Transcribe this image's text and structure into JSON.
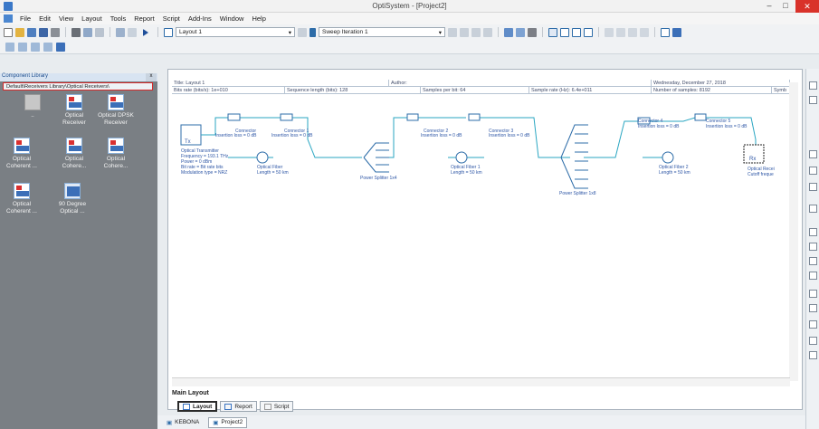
{
  "window": {
    "title": "OptiSystem - [Project2]",
    "min_glyph": "–",
    "max_glyph": "□",
    "close_glyph": "✕"
  },
  "menu": [
    "File",
    "Edit",
    "View",
    "Layout",
    "Tools",
    "Report",
    "Script",
    "Add-Ins",
    "Window",
    "Help"
  ],
  "toolbar": {
    "layout_combo": "Layout 1",
    "sweep_combo": "Sweep Iteration 1"
  },
  "library": {
    "header": "Component Library",
    "close": "x",
    "path": "Default\\Receivers Library\\Optical Receivers\\",
    "items": [
      {
        "label": ".."
      },
      {
        "label": "Optical Receiver"
      },
      {
        "label": "Optical DPSK Receiver"
      },
      {
        "label": "Optical Coherent ..."
      },
      {
        "label": "Optical Cohere..."
      },
      {
        "label": "Optical Cohere..."
      },
      {
        "label": "Optical Coherent ..."
      },
      {
        "label": "90 Degree Optical ..."
      }
    ]
  },
  "info": {
    "row1": [
      "Title: Layout 1",
      "Author:",
      "Wednesday, December 27, 2018"
    ],
    "row2": [
      "Bits rate (bits/s): 1e+010",
      "Sequence length (bits): 128",
      "Samples per bit: 64",
      "Sample rate (Hz): 6.4e+011",
      "Number of samples: 8192",
      "Symb"
    ]
  },
  "canvas": {
    "transmitter": {
      "title": "Tx",
      "lines": [
        "Optical Transmitter",
        "Frequency = 193.1 THz",
        "Power = 0 dBm",
        "Bit rate = Bit rate bits",
        "Modulation type = NRZ"
      ]
    },
    "connectors": [
      {
        "name": "Connector",
        "param": "Insertion loss = 0 dB"
      },
      {
        "name": "Connector 1",
        "param": "Insertion loss = 0 dB"
      },
      {
        "name": "Connector 2",
        "param": "Insertion loss = 0 dB"
      },
      {
        "name": "Connector 3",
        "param": "Insertion loss = 0 dB"
      },
      {
        "name": "Connector 4",
        "param": "Insertion loss = 0 dB"
      },
      {
        "name": "Connector 5",
        "param": "Insertion loss = 0 dB"
      }
    ],
    "fibers": [
      {
        "name": "Optical Fiber",
        "param": "Length = 50 km"
      },
      {
        "name": "Optical Fiber 1",
        "param": "Length = 50 km"
      },
      {
        "name": "Optical Fiber 2",
        "param": "Length = 50 km"
      }
    ],
    "splitters": [
      "Power Splitter 1x4",
      "Power Splitter 1x8"
    ],
    "receiver": {
      "title": "Rx",
      "lines": [
        "Optical Recei",
        "Cutoff freque"
      ]
    }
  },
  "tabs": {
    "main_layout": "Main Layout",
    "bottom": [
      "Layout",
      "Report",
      "Script"
    ]
  },
  "projects": [
    "KEBONA",
    "Project2"
  ],
  "colors": {
    "accent": "#2d6ca8",
    "library_bg": "#7a7f84",
    "close_red": "#d9322a"
  }
}
